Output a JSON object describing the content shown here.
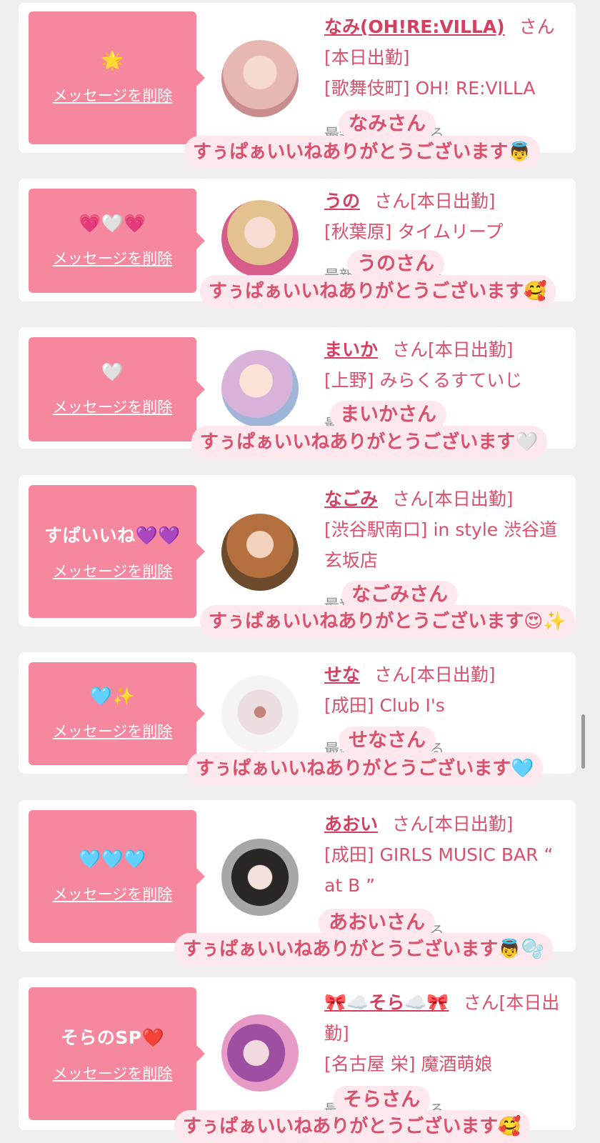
{
  "delete_label": "メッセージを削除",
  "view_label": "最新の投稿を見る",
  "items": [
    {
      "message": "🌟",
      "name": "なみ(OH!RE:VILLA)",
      "suffix": "さん[本日出勤]",
      "shop": "[歌舞伎町] OH! RE:VILLA",
      "caption_name": "なみさん",
      "caption_line": "すぅぱぁいいねありがとうございます👼",
      "avatar_color": "#e7b8b2"
    },
    {
      "message": "💗🤍💗",
      "name": "うの",
      "suffix": "さん[本日出勤]",
      "shop": "[秋葉原] タイムリープ",
      "caption_name": "うのさん",
      "caption_line": "すぅぱぁいいねありがとうございます🥰",
      "avatar_color": "#d98aa8"
    },
    {
      "message": "🤍",
      "name": "まいか",
      "suffix": "さん[本日出勤]",
      "shop": "[上野] みらくるすていじ",
      "caption_name": "まいかさん",
      "caption_line": "すぅぱぁいいねありがとうございます🤍",
      "avatar_color": "#c9b0d6"
    },
    {
      "message": "すぱいいね💜💜",
      "name": "なごみ",
      "suffix": "さん[本日出勤]",
      "shop": "[渋谷駅南口] in style 渋谷道玄坂店",
      "caption_name": "なごみさん",
      "caption_line": "すぅぱぁいいねありがとうございます😍✨",
      "avatar_color": "#b07a52"
    },
    {
      "message": "🩵✨",
      "name": "せな",
      "suffix": "さん[本日出勤]",
      "shop": "[成田] Club I's",
      "caption_name": "せなさん",
      "caption_line": "すぅぱぁいいねありがとうございます🩵",
      "avatar_color": "#ece6e6"
    },
    {
      "message": "🩵🩵🩵",
      "name": "あおい",
      "suffix": "さん[本日出勤]",
      "shop": "[成田] GIRLS MUSIC BAR “ at B ”",
      "caption_name": "あおいさん",
      "caption_line": "すぅぱぁいいねありがとうございます👼🫧",
      "avatar_color": "#bdbdbd"
    },
    {
      "message": "そらのSP❤️",
      "name": "🎀☁️そら☁️🎀",
      "suffix": "さん[本日出勤]",
      "shop": "[名古屋 栄] 魔酒萌娘",
      "caption_name": "そらさん",
      "caption_line": "すぅぱぁいいねありがとうございます🥰",
      "avatar_color": "#c77ab8"
    }
  ]
}
